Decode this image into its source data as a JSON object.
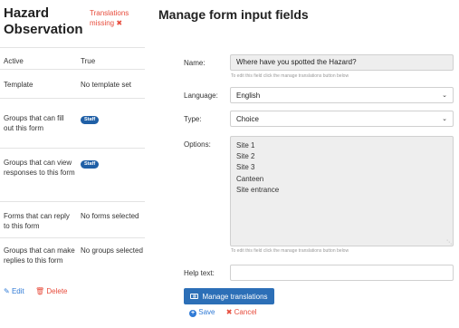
{
  "sidebar": {
    "title": "Hazard Observation",
    "warning": "Translations missing",
    "warning_icon": "✖",
    "rows": [
      {
        "label": "Active",
        "value": "True"
      },
      {
        "label": "Template",
        "value": "No template set"
      },
      {
        "label": "Groups that can fill out this form",
        "badge": "Staff"
      },
      {
        "label": "Groups that can view responses to this form",
        "badge": "Staff"
      },
      {
        "label": "Forms that can reply to this form",
        "value": "No forms selected"
      },
      {
        "label": "Groups that can make replies to this form",
        "value": "No groups selected"
      }
    ],
    "edit_label": "Edit",
    "delete_label": "Delete"
  },
  "main": {
    "title": "Manage form input fields",
    "name_label": "Name:",
    "name_value": "Where have you spotted the Hazard?",
    "name_hint": "To edit this field click the manage translations button below",
    "language_label": "Language:",
    "language_value": "English",
    "type_label": "Type:",
    "type_value": "Choice",
    "options_label": "Options:",
    "options": [
      "Site 1",
      "Site 2",
      "Site 3",
      "Canteen",
      "Site entrance"
    ],
    "options_hint": "To edit this field click the manage translations button below",
    "help_label": "Help text:",
    "help_value": "",
    "manage_button": "Manage translations",
    "save_label": "Save",
    "cancel_label": "Cancel"
  },
  "colors": {
    "primary": "#2c6fb7",
    "danger": "#e74c3c",
    "badge": "#1f5fa6"
  }
}
